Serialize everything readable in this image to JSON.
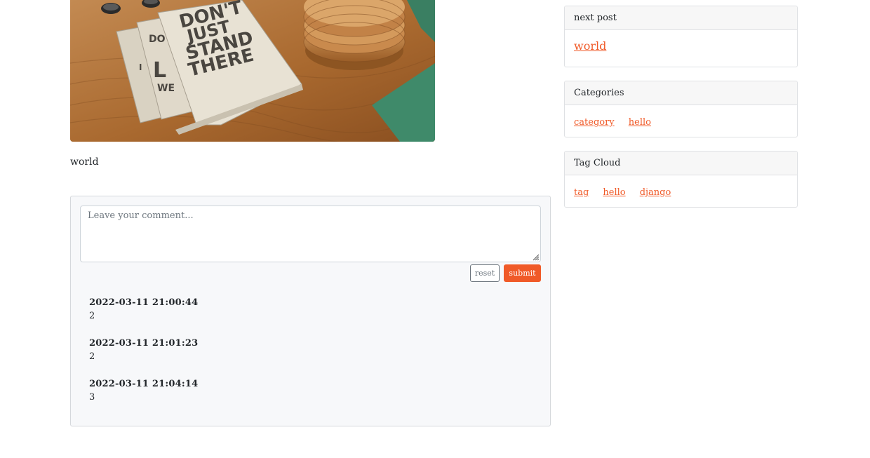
{
  "post": {
    "image_alt": "Notebooks on wooden desk",
    "image_text": [
      "DON'T",
      "JUST",
      "STAND",
      "THERE"
    ],
    "body_text": "world"
  },
  "comment_form": {
    "placeholder": "Leave your comment...",
    "reset_label": "reset",
    "submit_label": "submit"
  },
  "comments": [
    {
      "time": "2022-03-11 21:00:44",
      "text": "2"
    },
    {
      "time": "2022-03-11 21:01:23",
      "text": "2"
    },
    {
      "time": "2022-03-11 21:04:14",
      "text": "3"
    }
  ],
  "sidebar": {
    "next_post": {
      "title": "next post",
      "link": "world"
    },
    "categories": {
      "title": "Categories",
      "items": [
        "category",
        "hello"
      ]
    },
    "tag_cloud": {
      "title": "Tag Cloud",
      "items": [
        "tag",
        "hello",
        "django"
      ]
    }
  },
  "colors": {
    "accent": "#f05a28",
    "comment_bg": "#f7f8fa",
    "card_header_bg": "#f7f7f7"
  }
}
